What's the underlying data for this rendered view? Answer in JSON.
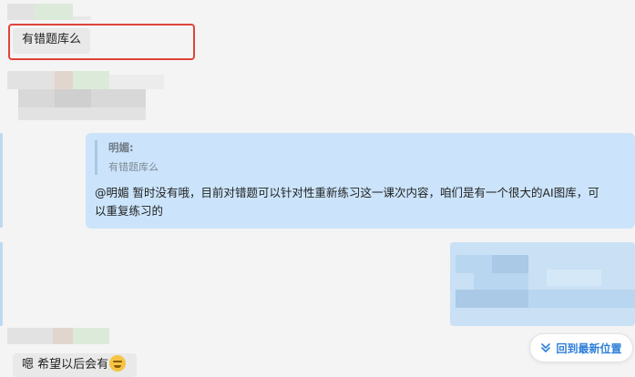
{
  "messages": {
    "msg1": {
      "text": "有错题库么"
    },
    "reply": {
      "quote_name": "明媚:",
      "quote_text": "有错题库么",
      "text_line1": "@明媚  暂时没有哦，目前对错题可以针对性重新练习这一课次内容，咱们是有一个很大的AI图库，可",
      "text_line2": "以重复练习的"
    },
    "msg3": {
      "text": "嗯 希望以后会有"
    }
  },
  "back_button": {
    "label": "回到最新位置",
    "icon": "double-chevron-down-icon"
  },
  "colors": {
    "accent": "#2f7fd8",
    "highlight": "#e0443a",
    "self_bubble": "#cbe4fb",
    "other_bubble": "#e9e9e9"
  }
}
